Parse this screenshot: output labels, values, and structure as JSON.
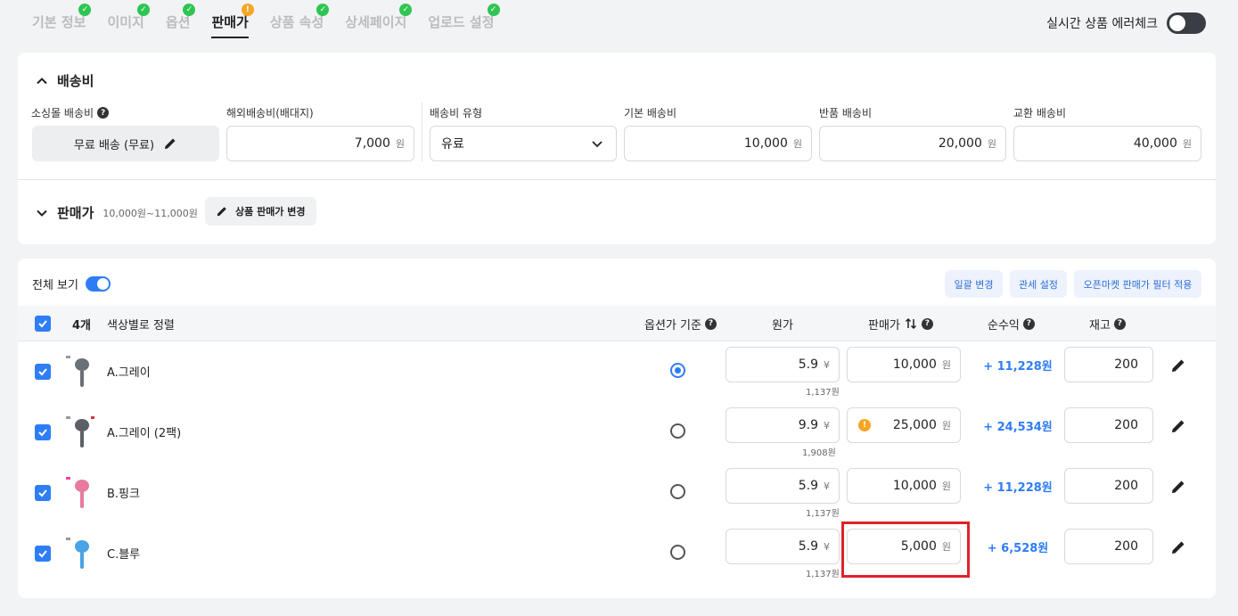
{
  "tabs": [
    {
      "label": "기본 정보",
      "status": "ok"
    },
    {
      "label": "이미지",
      "status": "ok"
    },
    {
      "label": "옵션",
      "status": "ok"
    },
    {
      "label": "판매가",
      "status": "warn"
    },
    {
      "label": "상품 속성",
      "status": "ok"
    },
    {
      "label": "상세페이지",
      "status": "ok"
    },
    {
      "label": "업로드 설정",
      "status": "ok"
    }
  ],
  "error_check": {
    "label": "실시간 상품 에러체크"
  },
  "shipping": {
    "title": "배송비",
    "mall_fee_label": "소싱몰 배송비",
    "mall_fee_value": "무료 배송 (무료)",
    "overseas_label": "해외배송비(배대지)",
    "overseas_value": "7,000",
    "type_label": "배송비 유형",
    "type_value": "유료",
    "basic_label": "기본 배송비",
    "basic_value": "10,000",
    "return_label": "반품 배송비",
    "return_value": "20,000",
    "exchange_label": "교환 배송비",
    "exchange_value": "40,000",
    "unit_won": "원"
  },
  "price": {
    "title": "판매가",
    "range": "10,000원~11,000원",
    "change_button": "상품 판매가 변경"
  },
  "list": {
    "view_all": "전체 보기",
    "btn_bulk": "일괄 변경",
    "btn_tax": "관세 설정",
    "btn_filter": "오픈마켓 판매가 필터 적용",
    "count": "4개",
    "sort_label": "색상별로 정렬",
    "col_option_base": "옵션가 기준",
    "col_cost": "원가",
    "col_price": "판매가",
    "col_profit": "순수익",
    "col_stock": "재고",
    "unit_yuan": "¥",
    "unit_won": "원"
  },
  "rows": [
    {
      "name": "A.그레이",
      "cost": "5.9",
      "cost_krw": "1,137원",
      "price": "10,000",
      "profit": "+ 11,228원",
      "stock": "200",
      "selected": true,
      "warn": false,
      "color": "#6b6f76"
    },
    {
      "name": "A.그레이 (2팩)",
      "cost": "9.9",
      "cost_krw": "1,908원",
      "price": "25,000",
      "profit": "+ 24,534원",
      "stock": "200",
      "selected": false,
      "warn": true,
      "color": "#5c6066"
    },
    {
      "name": "B.핑크",
      "cost": "5.9",
      "cost_krw": "1,137원",
      "price": "10,000",
      "profit": "+ 11,228원",
      "stock": "200",
      "selected": false,
      "warn": false,
      "color": "#e87aa0"
    },
    {
      "name": "C.블루",
      "cost": "5.9",
      "cost_krw": "1,137원",
      "price": "5,000",
      "profit": "+ 6,528원",
      "stock": "200",
      "selected": false,
      "warn": false,
      "color": "#4aa3e6"
    }
  ]
}
